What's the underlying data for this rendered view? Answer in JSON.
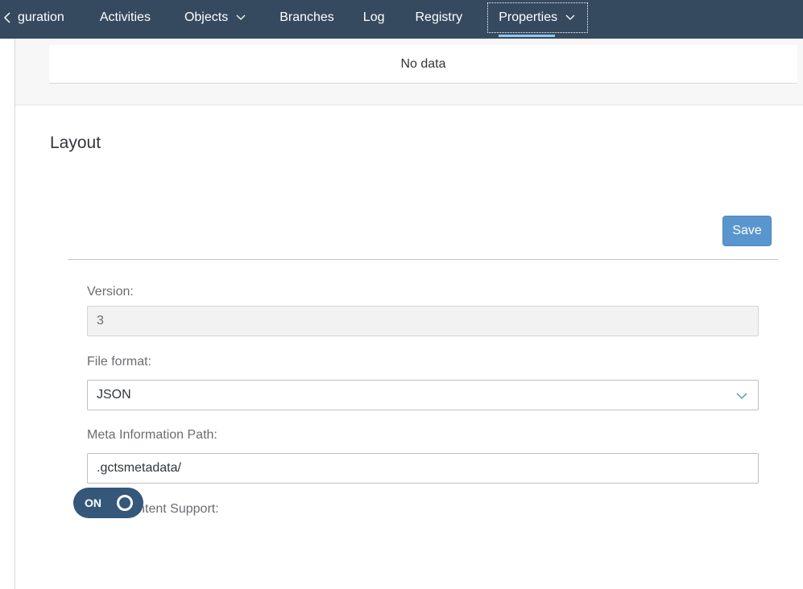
{
  "tabs": {
    "scroll_left_icon": "chevron-left-icon",
    "items": [
      {
        "label": "guration",
        "has_menu": false
      },
      {
        "label": "Activities",
        "has_menu": false
      },
      {
        "label": "Objects",
        "has_menu": true
      },
      {
        "label": "Branches",
        "has_menu": false
      },
      {
        "label": "Log",
        "has_menu": false
      },
      {
        "label": "Registry",
        "has_menu": false
      },
      {
        "label": "Properties",
        "has_menu": true,
        "selected": true
      }
    ]
  },
  "table": {
    "empty_text": "No data"
  },
  "layout_section": {
    "title": "Layout",
    "save_label": "Save",
    "version": {
      "label": "Version:",
      "value": "3"
    },
    "file_format": {
      "label": "File format:",
      "value": "JSON"
    },
    "meta_path": {
      "label": "Meta Information Path:",
      "value": ".gctsmetadata/"
    },
    "table_content_support": {
      "label": "Table Content Support:",
      "state_text": "ON",
      "enabled": true
    }
  },
  "colors": {
    "tabbar_bg": "#354a5f",
    "selected_indicator": "#91c8f6",
    "save_button": "#5a96ce",
    "switch_on": "#34577a"
  }
}
